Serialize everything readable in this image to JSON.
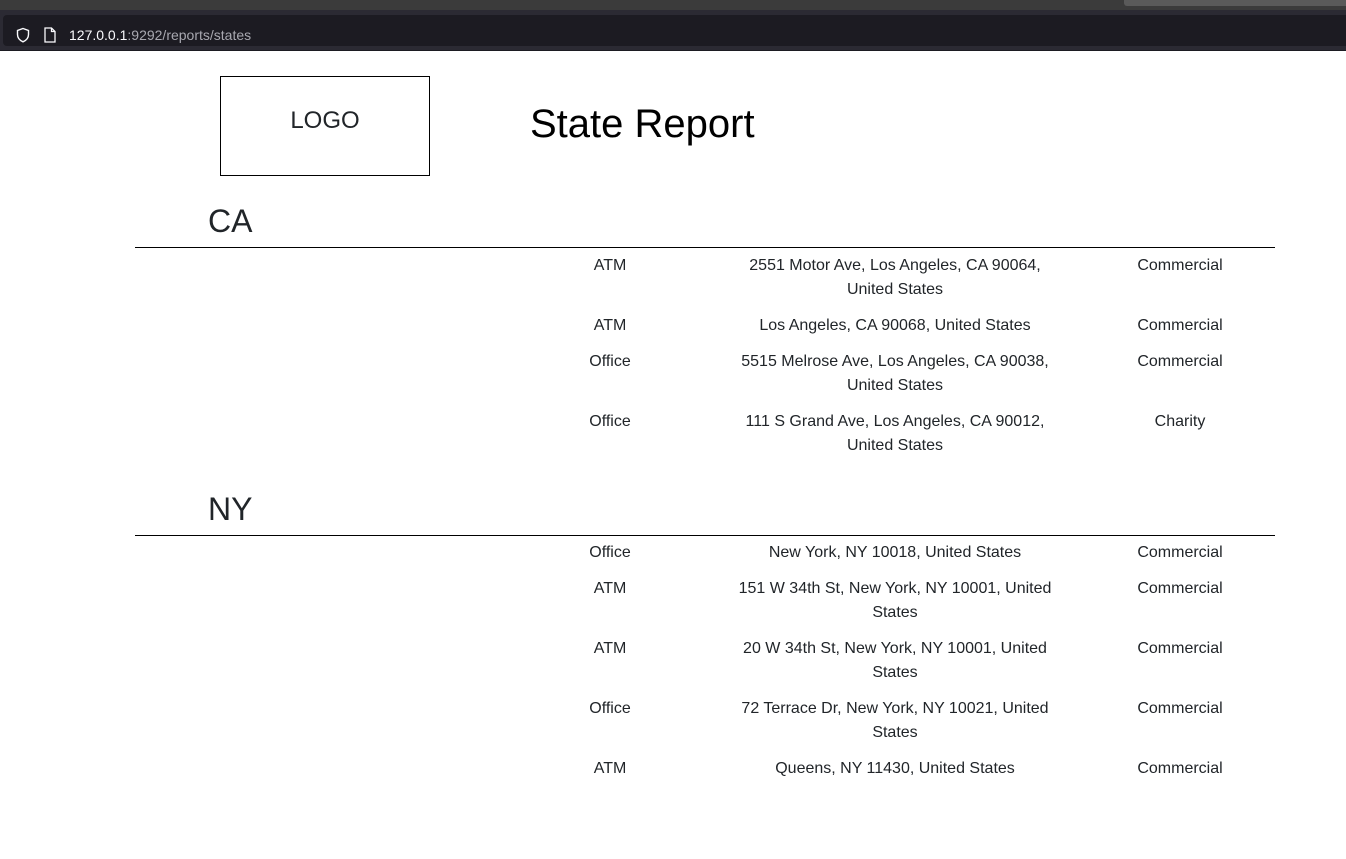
{
  "browser": {
    "url_host": "127.0.0.1",
    "url_rest": ":9292/reports/states"
  },
  "header": {
    "logo_text": "LOGO",
    "title": "State Report"
  },
  "states": [
    {
      "name": "CA",
      "rows": [
        {
          "type": "ATM",
          "address_line1": "2551 Motor Ave, Los Angeles, CA 90064,",
          "address_line2": "United States",
          "category": "Commercial"
        },
        {
          "type": "ATM",
          "address_line1": "Los Angeles, CA 90068, United States",
          "address_line2": "",
          "category": "Commercial"
        },
        {
          "type": "Office",
          "address_line1": "5515 Melrose Ave, Los Angeles, CA 90038,",
          "address_line2": "United States",
          "category": "Commercial"
        },
        {
          "type": "Office",
          "address_line1": "111 S Grand Ave, Los Angeles, CA 90012,",
          "address_line2": "United States",
          "category": "Charity"
        }
      ]
    },
    {
      "name": "NY",
      "rows": [
        {
          "type": "Office",
          "address_line1": "New York, NY 10018, United States",
          "address_line2": "",
          "category": "Commercial"
        },
        {
          "type": "ATM",
          "address_line1": "151 W 34th St, New York, NY 10001, United",
          "address_line2": "States",
          "category": "Commercial"
        },
        {
          "type": "ATM",
          "address_line1": "20 W 34th St, New York, NY 10001, United",
          "address_line2": "States",
          "category": "Commercial"
        },
        {
          "type": "Office",
          "address_line1": "72 Terrace Dr, New York, NY 10021, United",
          "address_line2": "States",
          "category": "Commercial"
        },
        {
          "type": "ATM",
          "address_line1": "Queens, NY 11430, United States",
          "address_line2": "",
          "category": "Commercial"
        }
      ]
    }
  ]
}
